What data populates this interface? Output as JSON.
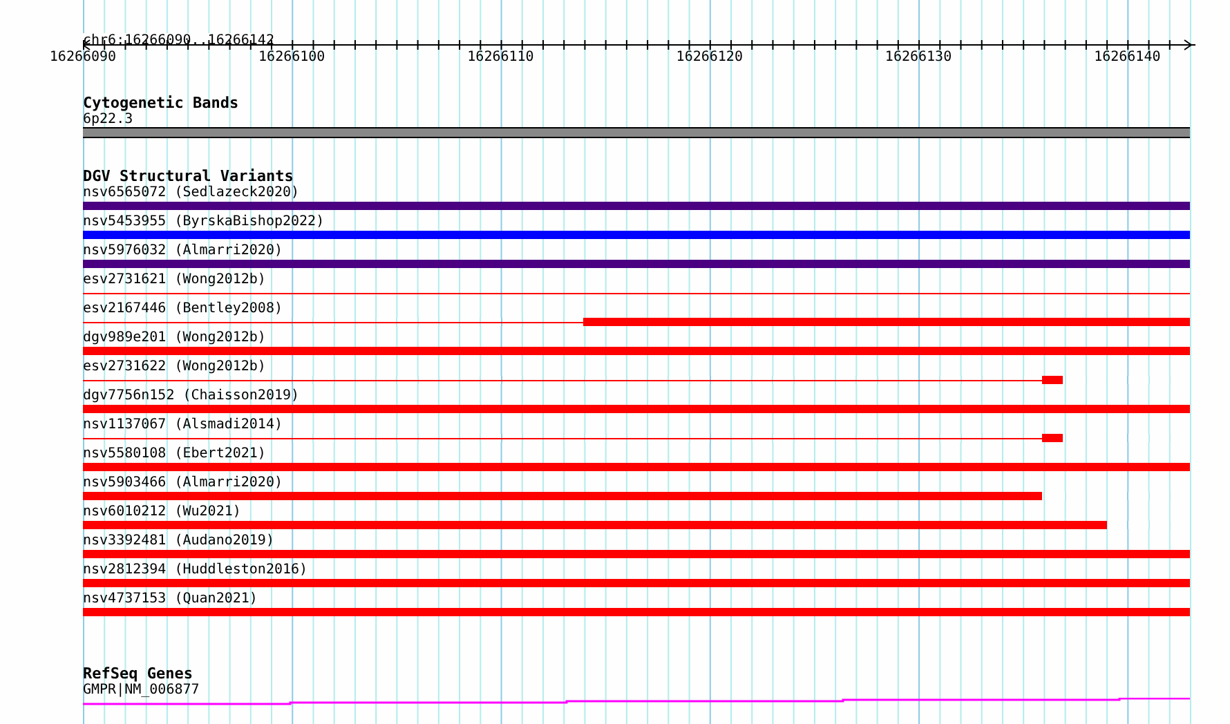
{
  "ruler": {
    "range": "chr6:16266090..16266142",
    "ticks": [
      "16266090",
      "16266100",
      "16266110",
      "16266120",
      "16266130",
      "16266140"
    ]
  },
  "cytogenetic_bands": {
    "title": "Cytogenetic Bands",
    "band": "6p22.3"
  },
  "dgv_structural_variants": {
    "title": "DGV Structural Variants",
    "variants": [
      {
        "label": "nsv6565072 (Sedlazeck2020)",
        "color": "#4b0082",
        "kind": "full"
      },
      {
        "label": "nsv5453955 (ByrskaBishop2022)",
        "color": "#0000ff",
        "kind": "full"
      },
      {
        "label": "nsv5976032 (Almarri2020)",
        "color": "#4b0082",
        "kind": "full"
      },
      {
        "label": "esv2731621 (Wong2012b)",
        "color": "#ff0000",
        "kind": "thin"
      },
      {
        "label": "esv2167446 (Bentley2008)",
        "color": "#ff0000",
        "kind": "thick_right",
        "level": 0.452
      },
      {
        "label": "dgv989e201 (Wong2012b)",
        "color": "#ff0000",
        "kind": "full"
      },
      {
        "label": "esv2731622 (Wong2012b)",
        "color": "#ff0000",
        "kind": "block",
        "level": 0.866
      },
      {
        "label": "dgv7756n152 (Chaisson2019)",
        "color": "#ff0000",
        "kind": "full"
      },
      {
        "label": "nsv1137067 (Alsmadi2014)",
        "color": "#ff0000",
        "kind": "block",
        "level": 0.866
      },
      {
        "label": "nsv5580108 (Ebert2021)",
        "color": "#ff0000",
        "kind": "full"
      },
      {
        "label": "nsv5903466 (Almarri2020)",
        "color": "#ff0000",
        "kind": "thick_left",
        "level": 0.866
      },
      {
        "label": "nsv6010212 (Wu2021)",
        "color": "#ff0000",
        "kind": "thick_left",
        "level": 0.925
      },
      {
        "label": "nsv3392481 (Audano2019)",
        "color": "#ff0000",
        "kind": "full"
      },
      {
        "label": "nsv2812394 (Huddleston2016)",
        "color": "#ff0000",
        "kind": "full"
      },
      {
        "label": "nsv4737153 (Quan2021)",
        "color": "#ff0000",
        "kind": "full"
      }
    ]
  },
  "refseq_genes": {
    "title": "RefSeq Genes",
    "gene": "GMPR|NM_006877"
  }
}
